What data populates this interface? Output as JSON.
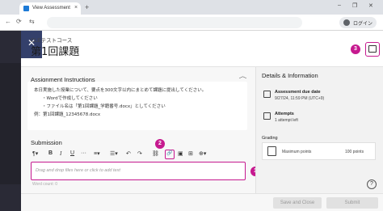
{
  "browser": {
    "tab_title": "View Assessment",
    "tab_close": "×",
    "new_tab": "+",
    "window_controls": [
      "–",
      "❐",
      "✕"
    ],
    "nav_back": "←",
    "nav_reload": "⟳",
    "nav_site": "⇆",
    "login_label": "ログイン"
  },
  "panel": {
    "close_label": "✕",
    "course_name": "CLEテストコース",
    "page_title": "第1回課題"
  },
  "instructions": {
    "heading": "Assignment Instructions",
    "lines": [
      "本日実施した授業について、要点を300文字以内にまとめて課題に提出してください。",
      "・Wordで作成してください",
      "・ファイル名は「第1回課題_学籍番号.docx」としてください",
      "例：第1回課題_12345678.docx"
    ]
  },
  "submission": {
    "heading": "Submission",
    "toolbar": [
      {
        "name": "format-icon",
        "glyph": "¶▾"
      },
      {
        "name": "bold-icon",
        "glyph": "B"
      },
      {
        "name": "italic-icon",
        "glyph": "I"
      },
      {
        "name": "underline-icon",
        "glyph": "U"
      },
      {
        "name": "more-text-icon",
        "glyph": "···"
      },
      {
        "name": "align-icon",
        "glyph": "≡▾"
      },
      {
        "name": "list-icon",
        "glyph": "☰▾"
      },
      {
        "name": "undo-icon",
        "glyph": "↶"
      },
      {
        "name": "redo-icon",
        "glyph": "↷"
      },
      {
        "name": "chain-icon",
        "glyph": "⛓"
      },
      {
        "name": "attach-link-icon",
        "glyph": "🔗"
      },
      {
        "name": "image-icon",
        "glyph": "▣"
      },
      {
        "name": "media-icon",
        "glyph": "⊞"
      },
      {
        "name": "add-content-icon",
        "glyph": "⊕▾"
      }
    ],
    "editor_placeholder": "Drag and drop files here or click to add text",
    "word_count": "Word count: 0"
  },
  "details": {
    "heading": "Details & Information",
    "due_title": "Assessment due date",
    "due_value": "9/27/24, 11:59 PM (UTC+9)",
    "attempts_title": "Attempts",
    "attempts_value": "1 attempt left",
    "grading_title": "Grading",
    "max_points_label": "Maximum points",
    "max_points_value": "100 points"
  },
  "footer": {
    "save_close": "Save and Close",
    "submit": "Submit",
    "help": "?"
  },
  "annotations": {
    "badge_1": "1",
    "badge_2": "2",
    "badge_3": "3",
    "accent_color": "#c6198f"
  }
}
